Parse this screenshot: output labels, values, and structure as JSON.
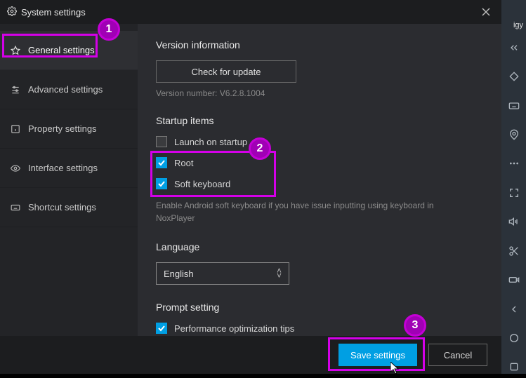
{
  "titlebar": {
    "title": "System settings"
  },
  "sidebar": {
    "items": [
      {
        "label": "General settings"
      },
      {
        "label": "Advanced settings"
      },
      {
        "label": "Property settings"
      },
      {
        "label": "Interface settings"
      },
      {
        "label": "Shortcut settings"
      }
    ]
  },
  "version_section": {
    "title": "Version information",
    "check_update_label": "Check for update",
    "version_text": "Version number: V6.2.8.1004"
  },
  "startup_section": {
    "title": "Startup items",
    "items": [
      {
        "label": "Launch on startup",
        "checked": false
      },
      {
        "label": "Root",
        "checked": true
      },
      {
        "label": "Soft keyboard",
        "checked": true
      }
    ],
    "hint": "Enable Android soft keyboard if you have issue inputting using keyboard in NoxPlayer"
  },
  "language_section": {
    "title": "Language",
    "selected": "English"
  },
  "prompt_section": {
    "title": "Prompt setting",
    "items": [
      {
        "label": "Performance optimization tips",
        "checked": true
      }
    ]
  },
  "footer": {
    "save_label": "Save settings",
    "cancel_label": "Cancel"
  },
  "right_rail": {
    "tag": "igy"
  },
  "annotations": {
    "m1": "1",
    "m2": "2",
    "m3": "3"
  },
  "colors": {
    "accent": "#009fe3",
    "magenta": "#d400e8",
    "bg_dark": "#2b2c30"
  }
}
